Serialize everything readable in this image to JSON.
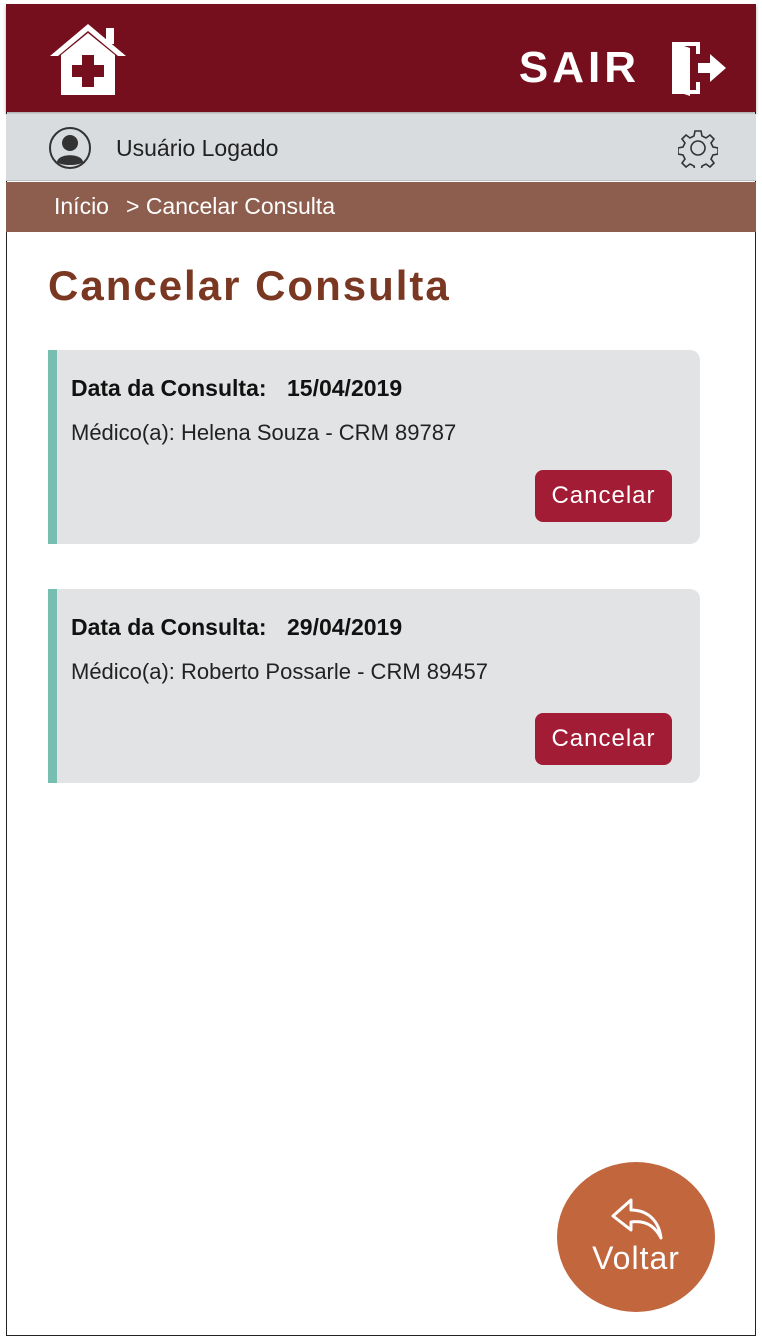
{
  "header": {
    "logout_label": "SAIR",
    "home_icon": "home-medical-icon",
    "logout_icon": "logout-door-icon",
    "bg_color": "#750f1d"
  },
  "user": {
    "name": "Usuário Logado",
    "avatar_icon": "user-avatar-icon",
    "settings_icon": "gear-icon"
  },
  "breadcrumb": {
    "home": "Início",
    "current": "> Cancelar Consulta"
  },
  "page": {
    "title": "Cancelar Consulta"
  },
  "appointments": [
    {
      "date_label": "Data da Consulta:",
      "date": "15/04/2019",
      "doctor": "Médico(a): Helena Souza - CRM 89787",
      "cancel_label": "Cancelar"
    },
    {
      "date_label": "Data da Consulta:",
      "date": "29/04/2019",
      "doctor": "Médico(a): Roberto Possarle - CRM 89457",
      "cancel_label": "Cancelar"
    }
  ],
  "back_button": {
    "label": "Voltar",
    "icon": "reply-arrow-icon"
  },
  "colors": {
    "accent": "#a21c36",
    "breadcrumb": "#8d5e4d",
    "card_border": "#76bfb0",
    "back": "#c2663e"
  }
}
